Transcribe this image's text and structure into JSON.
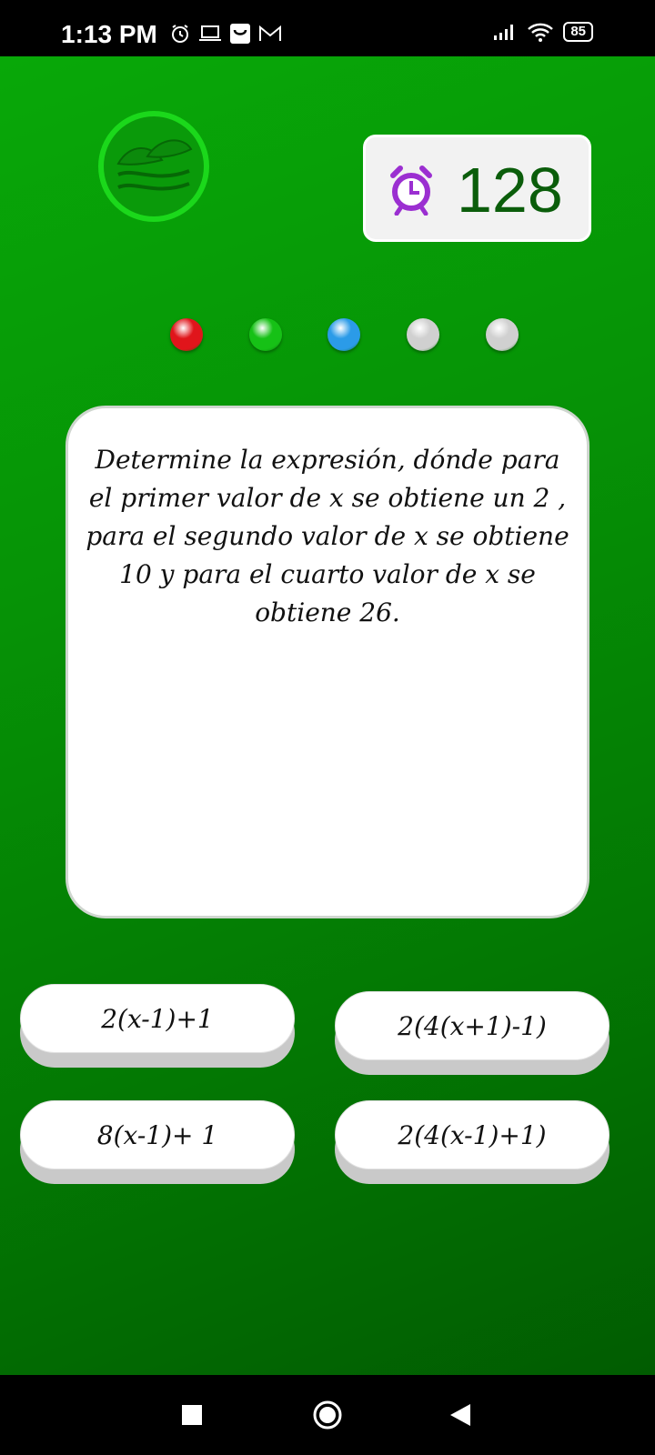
{
  "status_bar": {
    "time": "1:13 PM",
    "battery": "85",
    "icons": [
      "alarm-icon",
      "laptop-icon",
      "shopping-bag-icon",
      "gmail-icon",
      "signal-icon",
      "wifi-icon",
      "battery-icon"
    ]
  },
  "timer": {
    "value": "128",
    "icon": "alarm-clock-icon"
  },
  "progress_dots": [
    {
      "state": "wrong",
      "color": "#e0151b"
    },
    {
      "state": "correct",
      "color": "#16c116"
    },
    {
      "state": "current",
      "color": "#2b9be8"
    },
    {
      "state": "pending",
      "color": "#d0d0d0"
    },
    {
      "state": "pending",
      "color": "#d0d0d0"
    }
  ],
  "question": {
    "text": "Determine la expresión, dónde para el primer valor de x se obtiene un 2 , para el segundo valor de x se obtiene 10 y para el cuarto valor de x se obtiene 26."
  },
  "answers": [
    {
      "label": "2(x-1)+1"
    },
    {
      "label": "2(4(x+1)-1)"
    },
    {
      "label": "8(x-1)+ 1"
    },
    {
      "label": "2(4(x-1)+1)"
    }
  ],
  "colors": {
    "background_top": "#08a808",
    "background_bottom": "#015c01",
    "timer_text": "#0b5d0b",
    "alarm_icon": "#9b2fd1"
  }
}
